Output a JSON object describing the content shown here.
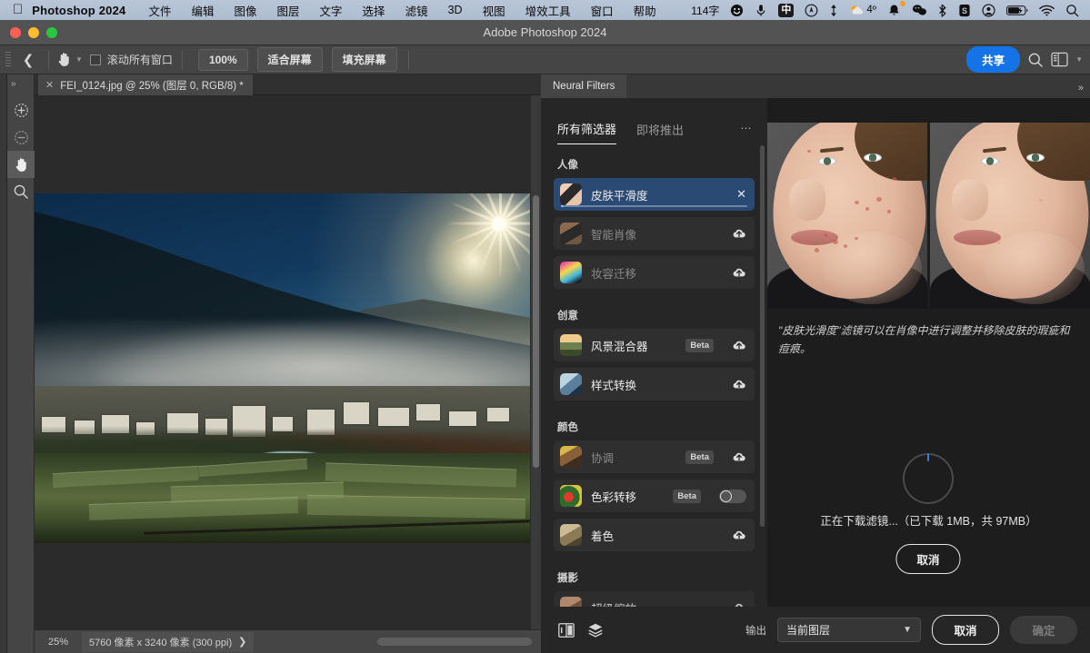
{
  "macbar": {
    "apple_icon": "apple-icon",
    "app_name": "Photoshop 2024",
    "menus": [
      "文件",
      "编辑",
      "图像",
      "图层",
      "文字",
      "选择",
      "滤镜",
      "3D",
      "视图",
      "增效工具",
      "窗口",
      "帮助"
    ],
    "status_items": [
      {
        "name": "word-count",
        "label": "114字"
      },
      {
        "name": "smiley-icon",
        "label": ""
      },
      {
        "name": "microphone-icon",
        "label": ""
      },
      {
        "name": "input-method-icon",
        "label": "中"
      },
      {
        "name": "compass-icon",
        "label": ""
      },
      {
        "name": "vertical-arrows-icon",
        "label": ""
      },
      {
        "name": "weather-icon",
        "label": "4º"
      },
      {
        "name": "notification-bell-icon",
        "label": ""
      },
      {
        "name": "wechat-icon",
        "label": ""
      },
      {
        "name": "bluetooth-icon",
        "label": ""
      },
      {
        "name": "snipaste-icon",
        "label": "S"
      },
      {
        "name": "user-account-icon",
        "label": ""
      },
      {
        "name": "battery-charging-icon",
        "label": ""
      },
      {
        "name": "wifi-icon",
        "label": ""
      },
      {
        "name": "spotlight-search-icon",
        "label": ""
      }
    ]
  },
  "window": {
    "title": "Adobe Photoshop 2024"
  },
  "options_bar": {
    "back_icon": "back-chevron-icon",
    "tool_icon": "hand-tool-icon",
    "scroll_all_windows_label": "滚动所有窗口",
    "buttons": [
      "100%",
      "适合屏幕",
      "填充屏幕"
    ],
    "share_label": "共享",
    "search_icon": "search-icon",
    "workspace_icon": "workspace-icon",
    "workspace_caret": "chevron-down-icon"
  },
  "tools": [
    {
      "name": "zoom-in-tool",
      "icon": "plus-circle-icon",
      "active": false
    },
    {
      "name": "zoom-out-tool",
      "icon": "minus-circle-icon",
      "active": false
    },
    {
      "name": "hand-tool",
      "icon": "hand-icon",
      "active": true
    },
    {
      "name": "magnifier-tool",
      "icon": "magnifier-icon",
      "active": false
    }
  ],
  "document": {
    "tab_title": "FEI_0124.jpg @ 25% (图层 0, RGB/8) *",
    "close_icon": "close-icon"
  },
  "status_bar": {
    "zoom": "25%",
    "dimensions": "5760 像素 x 3240 像素 (300 ppi)",
    "expand_icon": "chevron-right-icon"
  },
  "neural_filters": {
    "panel_tab": "Neural Filters",
    "collapse_icon": "expand-panel-icon",
    "list_tabs": [
      {
        "label": "所有筛选器",
        "active": true
      },
      {
        "label": "即将推出",
        "active": false
      }
    ],
    "overflow_icon": "more-options-icon",
    "groups": [
      {
        "title": "人像",
        "filters": [
          {
            "name": "皮肤平滑度",
            "selected": true,
            "dim": false,
            "beta": null,
            "action": "close",
            "progress": true,
            "thumb": "portrait-skin"
          },
          {
            "name": "智能肖像",
            "selected": false,
            "dim": true,
            "beta": null,
            "action": "download",
            "progress": false,
            "thumb": "portrait-smart"
          },
          {
            "name": "妆容迁移",
            "selected": false,
            "dim": true,
            "beta": null,
            "action": "download",
            "progress": false,
            "thumb": "portrait-makeup"
          }
        ]
      },
      {
        "title": "创意",
        "filters": [
          {
            "name": "风景混合器",
            "selected": false,
            "dim": false,
            "beta": "Beta",
            "action": "download",
            "progress": false,
            "thumb": "landscape-mixer"
          },
          {
            "name": "样式转换",
            "selected": false,
            "dim": false,
            "beta": null,
            "action": "download",
            "progress": false,
            "thumb": "style-transfer"
          }
        ]
      },
      {
        "title": "颜色",
        "filters": [
          {
            "name": "协调",
            "selected": false,
            "dim": true,
            "beta": "Beta",
            "action": "download",
            "progress": false,
            "thumb": "harmonization"
          },
          {
            "name": "色彩转移",
            "selected": false,
            "dim": false,
            "beta": "Beta",
            "action": "toggle",
            "progress": false,
            "thumb": "color-transfer"
          },
          {
            "name": "着色",
            "selected": false,
            "dim": false,
            "beta": null,
            "action": "download",
            "progress": false,
            "thumb": "colorize"
          }
        ]
      },
      {
        "title": "摄影",
        "filters": [
          {
            "name": "超级缩放",
            "selected": false,
            "dim": false,
            "beta": null,
            "action": "download",
            "progress": false,
            "thumb": "super-zoom"
          }
        ]
      }
    ],
    "preview": {
      "before_label": "",
      "after_label": "",
      "description": "\"皮肤光滑度\"滤镜可以在肖像中进行调整并移除皮肤的瑕疵和痘痕。",
      "download_status": "正在下载滤镜...（已下载 1MB，共 97MB）",
      "cancel_label": "取消"
    },
    "footer": {
      "compare_icon": "before-after-compare-icon",
      "layers_icon": "layers-stack-icon",
      "output_label": "输出",
      "output_value": "当前图层",
      "output_caret": "chevron-down-icon",
      "cancel_label": "取消",
      "ok_label": "确定"
    }
  },
  "colors": {
    "accent_blue": "#1473e6",
    "selection_blue": "#2a4a74",
    "panel_bg": "#1d1d1d",
    "chrome_bg": "#454545",
    "menubar_bg": "#b9c6d8"
  }
}
